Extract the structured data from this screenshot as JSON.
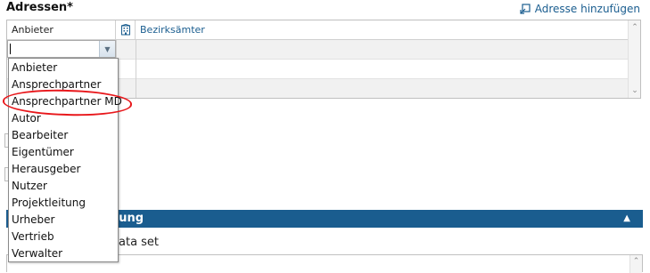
{
  "section": {
    "title": "Adressen*"
  },
  "add_address": {
    "label": "Adresse hinzufügen",
    "icon": "add-address-icon"
  },
  "grid": {
    "columns": [
      "Anbieter",
      "Bezirksämter"
    ],
    "building_icon": "building-icon"
  },
  "combo": {
    "value": ""
  },
  "dropdown": {
    "items": [
      "Anbieter",
      "Ansprechpartner",
      "Ansprechpartner MD",
      "Autor",
      "Bearbeiter",
      "Eigentümer",
      "Herausgeber",
      "Nutzer",
      "Projektleitung",
      "Urheber",
      "Vertrieb",
      "Verwalter"
    ],
    "highlighted": "Ansprechpartner MD",
    "highlight_color": "#e8171b"
  },
  "panel": {
    "title_fragment": "tung",
    "subtitle_fragment": "ata set",
    "bar_color": "#1a5d8f"
  }
}
